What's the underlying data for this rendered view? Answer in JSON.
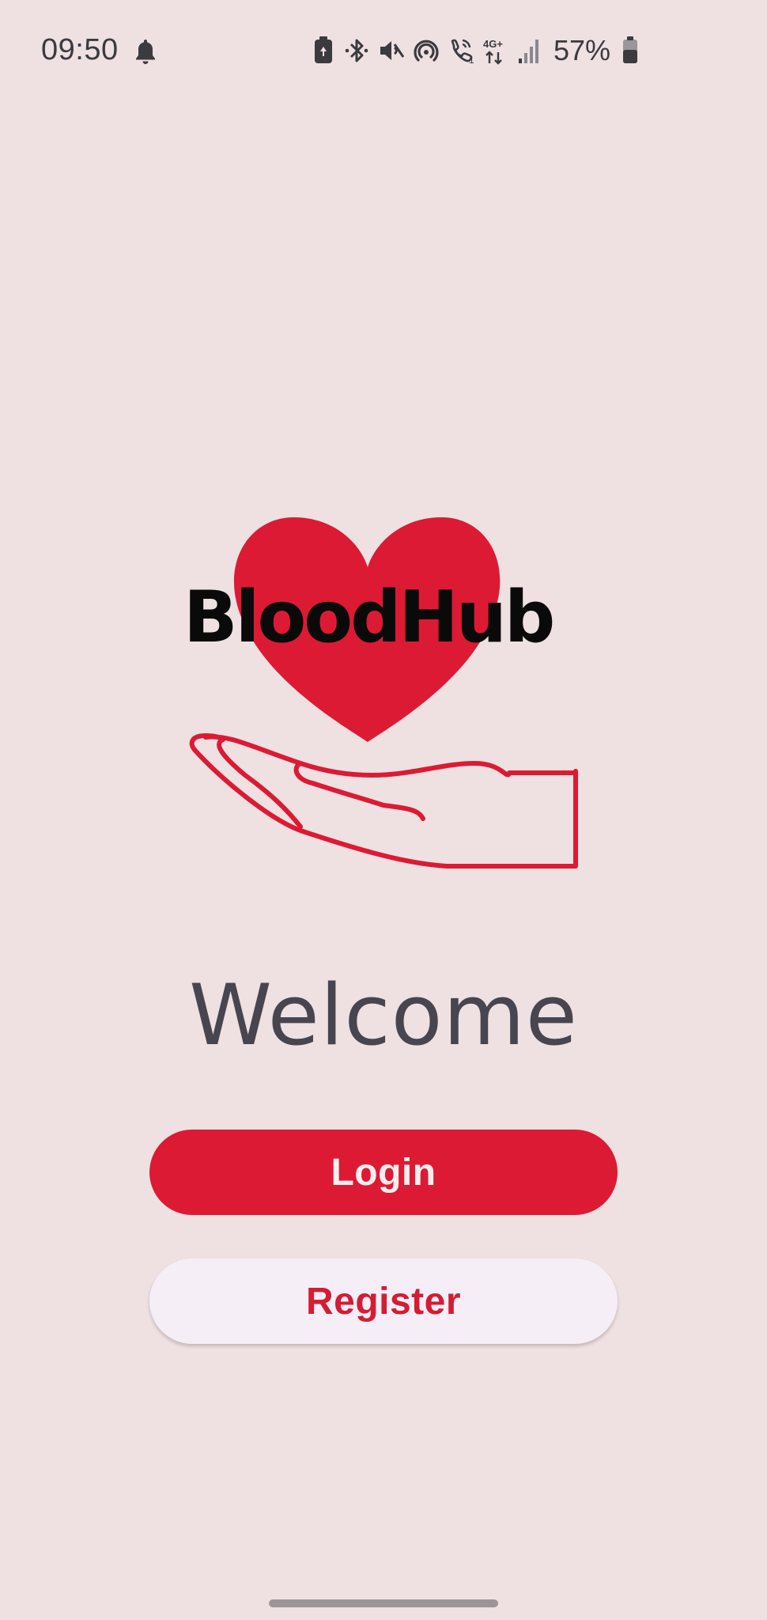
{
  "status_bar": {
    "time": "09:50",
    "network_label": "4G+",
    "sim_slot": "1",
    "battery_percent": "57%"
  },
  "logo": {
    "brand_name": "BloodHub",
    "heart_color": "#dc1a33"
  },
  "welcome": {
    "heading": "Welcome"
  },
  "actions": {
    "login_label": "Login",
    "register_label": "Register"
  },
  "colors": {
    "accent": "#dc1a33",
    "background": "#efe0e2",
    "register_button_bg": "#f5eef6"
  },
  "icons": {
    "status_bar": [
      "bell-icon",
      "battery-saver-icon",
      "bluetooth-icon",
      "mute-icon",
      "hotspot-icon",
      "wifi-calling-icon",
      "network-4g-icon",
      "signal-icon",
      "battery-icon"
    ],
    "logo": [
      "heart-icon",
      "hand-icon"
    ]
  }
}
